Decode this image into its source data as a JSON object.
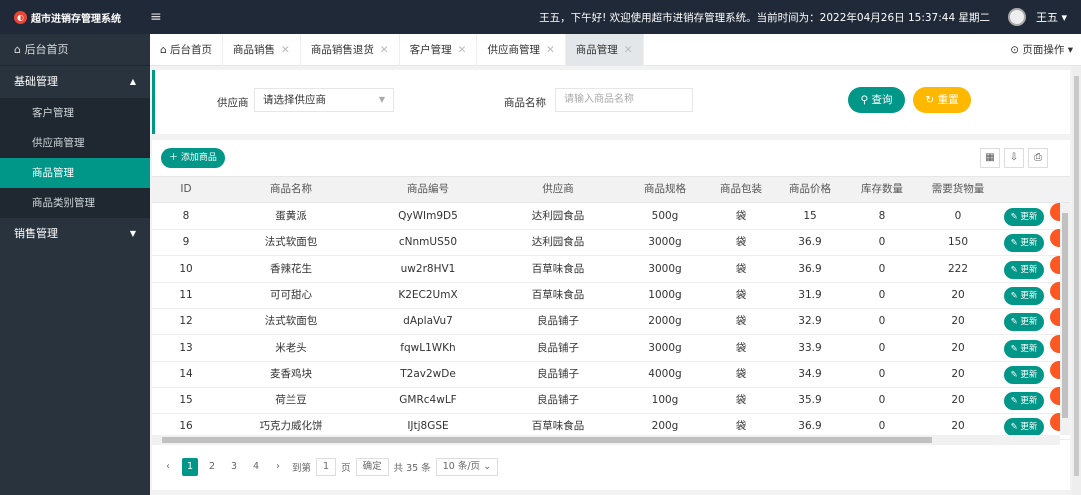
{
  "header": {
    "app_title": "超市进销存管理系统",
    "welcome": "王五，下午好! 欢迎使用超市进销存管理系统。当前时间为：2022年04月26日 15:37:44 星期二",
    "user": "王五"
  },
  "sidebar": {
    "home": "后台首页",
    "groups": [
      {
        "label": "基础管理",
        "items": [
          "客户管理",
          "供应商管理",
          "商品管理",
          "商品类别管理"
        ]
      },
      {
        "label": "销售管理"
      }
    ]
  },
  "tabs": [
    "后台首页",
    "商品销售",
    "商品销售退货",
    "客户管理",
    "供应商管理",
    "商品管理"
  ],
  "page_op": "页面操作",
  "search": {
    "supplier_label": "供应商",
    "supplier_value": "请选择供应商",
    "name_label": "商品名称",
    "name_placeholder": "请输入商品名称",
    "query": "查询",
    "reset": "重置"
  },
  "toolbar": {
    "add": "添加商品"
  },
  "table": {
    "columns": [
      "ID",
      "商品名称",
      "商品编号",
      "供应商",
      "商品规格",
      "商品包装",
      "商品价格",
      "库存数量",
      "需要货物量"
    ],
    "update_label": "更新",
    "rows": [
      [
        "8",
        "蛋黄派",
        "QyWIm9D5",
        "达利园食品",
        "500g",
        "袋",
        "15",
        "8",
        "0"
      ],
      [
        "9",
        "法式软面包",
        "cNnmUS50",
        "达利园食品",
        "3000g",
        "袋",
        "36.9",
        "0",
        "150"
      ],
      [
        "10",
        "香辣花生",
        "uw2r8HV1",
        "百草味食品",
        "3000g",
        "袋",
        "36.9",
        "0",
        "222"
      ],
      [
        "11",
        "可可甜心",
        "K2EC2UmX",
        "百草味食品",
        "1000g",
        "袋",
        "31.9",
        "0",
        "20"
      ],
      [
        "12",
        "法式软面包",
        "dAplaVu7",
        "良品铺子",
        "2000g",
        "袋",
        "32.9",
        "0",
        "20"
      ],
      [
        "13",
        "米老头",
        "fqwL1WKh",
        "良品铺子",
        "3000g",
        "袋",
        "33.9",
        "0",
        "20"
      ],
      [
        "14",
        "麦香鸡块",
        "T2av2wDe",
        "良品铺子",
        "4000g",
        "袋",
        "34.9",
        "0",
        "20"
      ],
      [
        "15",
        "荷兰豆",
        "GMRc4wLF",
        "良品铺子",
        "100g",
        "袋",
        "35.9",
        "0",
        "20"
      ],
      [
        "16",
        "巧克力威化饼",
        "IJtj8GSE",
        "百草味食品",
        "200g",
        "袋",
        "36.9",
        "0",
        "20"
      ]
    ]
  },
  "pager": {
    "pages": [
      "1",
      "2",
      "3",
      "4"
    ],
    "goto": "到第",
    "page_value": "1",
    "page_unit": "页",
    "confirm": "确定",
    "total": "共 35 条",
    "per_page": "10 条/页"
  },
  "colors": {
    "accent": "#009688",
    "warn": "#ffb800",
    "danger": "#ff5722",
    "sidebar": "#28333e",
    "topbar": "#1f2937"
  }
}
